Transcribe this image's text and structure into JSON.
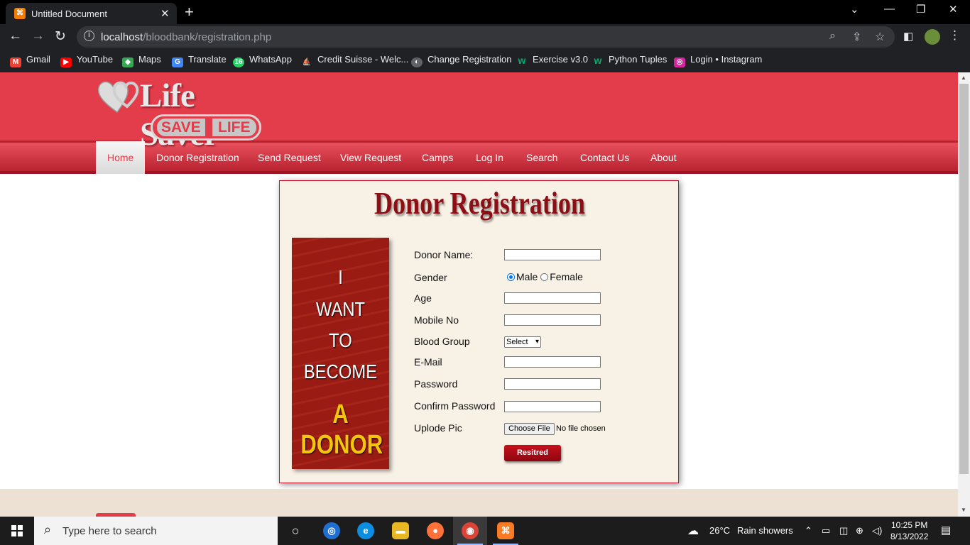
{
  "browser": {
    "tab_title": "Untitled Document",
    "tab_favicon": "xampp-icon",
    "url_host": "localhost",
    "url_path": "/bloodbank/registration.php",
    "bookmarks": [
      {
        "label": "Gmail",
        "color": "#ea4335",
        "glyph": "M"
      },
      {
        "label": "YouTube",
        "color": "#ff0000",
        "glyph": "▶"
      },
      {
        "label": "Maps",
        "color": "#34a853",
        "glyph": "◆"
      },
      {
        "label": "Translate",
        "color": "#4285f4",
        "glyph": "G"
      },
      {
        "label": "WhatsApp",
        "color": "#25d366",
        "glyph": "16"
      },
      {
        "label": "Credit Suisse - Welc...",
        "color": "#1a3a6b",
        "glyph": "⛵"
      },
      {
        "label": "Change Registration",
        "color": "#5f6368",
        "glyph": "◐"
      },
      {
        "label": "Exercise v3.0",
        "color": "#04aa6d",
        "glyph": "w"
      },
      {
        "label": "Python Tuples",
        "color": "#04aa6d",
        "glyph": "w"
      },
      {
        "label": "Login • Instagram",
        "color": "#d6249f",
        "glyph": "◎"
      }
    ]
  },
  "site": {
    "logo_text": "Life Saver",
    "logo_save": "SAVE",
    "logo_life": "LIFE",
    "nav": [
      "Home",
      "Donor Registration",
      "Send Request",
      "View Request",
      "Camps",
      "Log In",
      "Search",
      "Contact Us",
      "About"
    ],
    "active_nav": "Home"
  },
  "form": {
    "title": "Donor Registration",
    "banner": {
      "line1": "I",
      "line2": "WANT",
      "line3": "TO",
      "line4": "BECOME",
      "line5": "A DONOR"
    },
    "labels": {
      "donor_name": "Donor Name:",
      "gender": "Gender",
      "age": "Age",
      "mobile": "Mobile No",
      "blood_group": "Blood Group",
      "email": "E-Mail",
      "password": "Password",
      "confirm_password": "Confirm Password",
      "upload_pic": "Uplode Pic"
    },
    "gender_options": {
      "male": "Male",
      "female": "Female",
      "selected": "Male"
    },
    "blood_group_selected": "Select",
    "file_button": "Choose File",
    "file_status": "No file chosen",
    "submit": "Resitred"
  },
  "taskbar": {
    "search_placeholder": "Type here to search",
    "weather_temp": "26°C",
    "weather_text": "Rain showers",
    "time": "10:25 PM",
    "date": "8/13/2022"
  }
}
